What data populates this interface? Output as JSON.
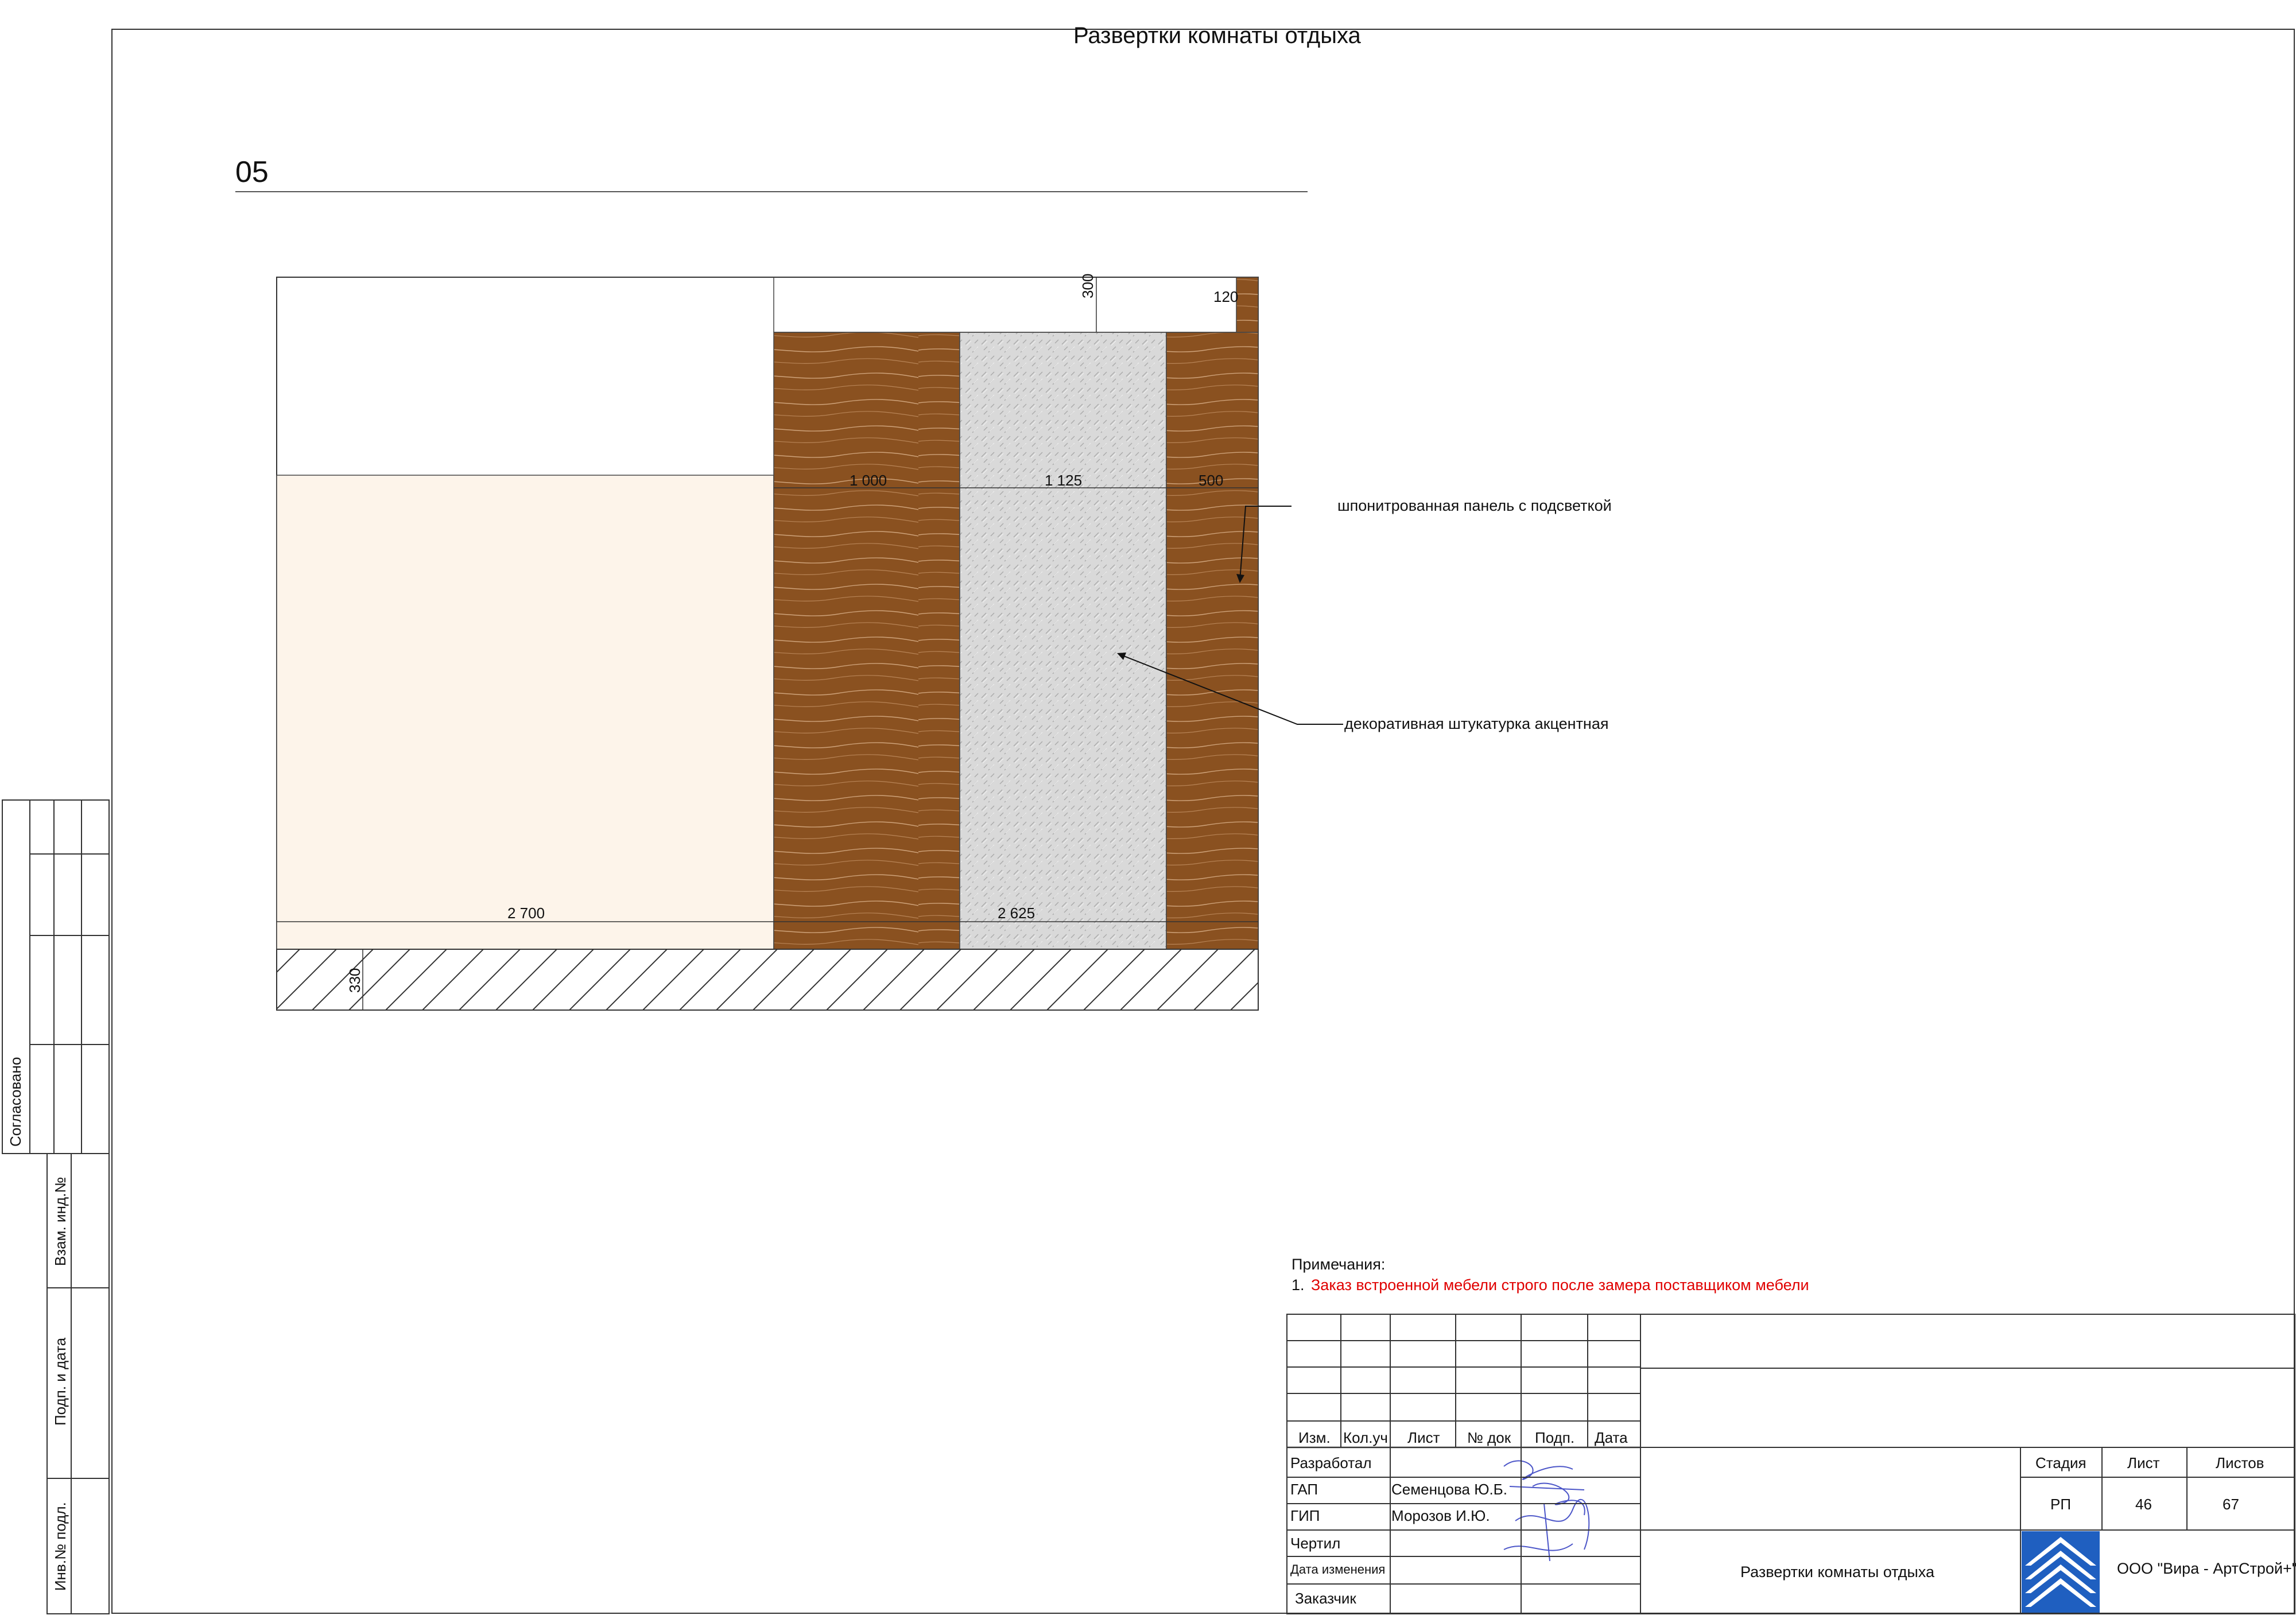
{
  "sheet_title": "Развертки комнаты отдыха",
  "view_number": "05",
  "dimensions": {
    "top_300": "300",
    "top_120": "120",
    "mid_1000": "1 000",
    "mid_1125": "1 125",
    "mid_500": "500",
    "bottom_2700": "2 700",
    "bottom_2625": "2 625",
    "floor_330": "330"
  },
  "callouts": {
    "veneer_panel": "шпонитрованная панель с подсветкой",
    "plaster": "декоративная штукатурка акцентная"
  },
  "notes": {
    "heading": "Примечания:",
    "number": "1.",
    "text": "Заказ встроенной мебели строго после замера поставщиком мебели",
    "color": "#e00000"
  },
  "side_stamp": {
    "agreed": "Согласовано",
    "replace_inv": "Взам. инд.№",
    "sign_date": "Подп. и дата",
    "inv_orig": "Инв.№ подл."
  },
  "title_block": {
    "header": [
      "Изм.",
      "Кол.уч",
      "Лист",
      "№ док",
      "Подп.",
      "Дата"
    ],
    "rows": [
      {
        "role": "Разработал",
        "name": ""
      },
      {
        "role": "ГАП",
        "name": "Семенцова Ю.Б."
      },
      {
        "role": "ГИП",
        "name": "Морозов И.Ю."
      },
      {
        "role": "Чертил",
        "name": ""
      },
      {
        "role": "Дата изменения",
        "name": ""
      },
      {
        "role": "Заказчик",
        "name": ""
      }
    ],
    "stage_label": "Стадия",
    "sheet_label": "Лист",
    "sheets_label": "Листов",
    "stage": "РП",
    "sheet": "46",
    "sheets": "67",
    "drawing_name": "Развертки комнаты отдыха",
    "company": "ООО \"Вира - АртСтрой+\""
  },
  "colors": {
    "wood": "#8a5120",
    "plaster": "#d7d7d7",
    "wall_beige": "#fdf4ea",
    "signature": "#4b55c8",
    "logo_blue": "#1f5fc0"
  }
}
